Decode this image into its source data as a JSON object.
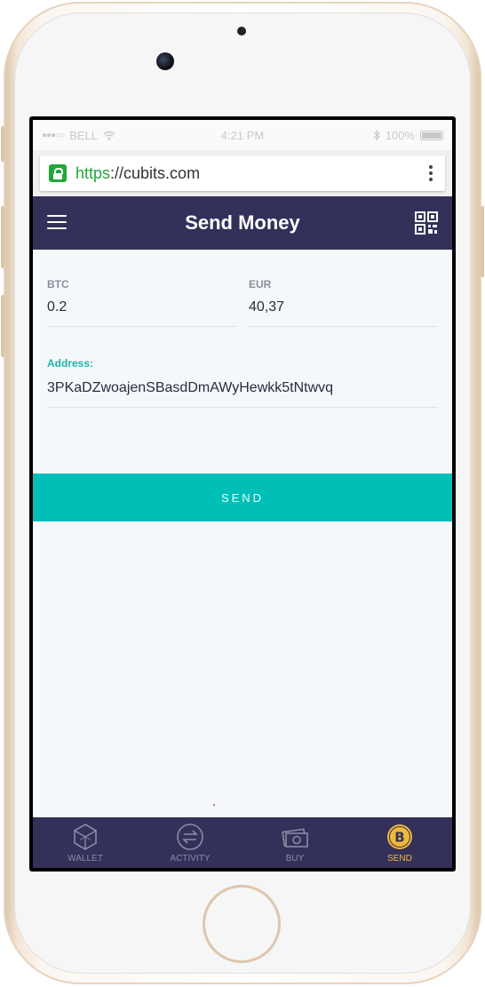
{
  "status_bar": {
    "carrier": "BELL",
    "time": "4:21 PM",
    "battery": "100%"
  },
  "browser": {
    "url_scheme": "https",
    "url_rest": "://cubits.com"
  },
  "header": {
    "title": "Send Money"
  },
  "form": {
    "btc_label": "BTC",
    "btc_value": "0.2",
    "eur_label": "EUR",
    "eur_value": "40,37",
    "address_label": "Address:",
    "address_value": "3PKaDZwoajenSBasdDmAWyHewkk5tNtwvq",
    "send_label": "SEND"
  },
  "bottom_nav": {
    "items": [
      {
        "label": "WALLET",
        "icon": "wallet-hexagon-icon",
        "active": false
      },
      {
        "label": "ACTIVITY",
        "icon": "activity-arrows-icon",
        "active": false
      },
      {
        "label": "BUY",
        "icon": "buy-cash-icon",
        "active": false
      },
      {
        "label": "SEND",
        "icon": "bitcoin-icon",
        "active": true
      }
    ]
  },
  "colors": {
    "header_bg": "#33315a",
    "accent_teal": "#00bfb7",
    "active_nav": "#f1b93a",
    "secure_green": "#1fa83a"
  }
}
